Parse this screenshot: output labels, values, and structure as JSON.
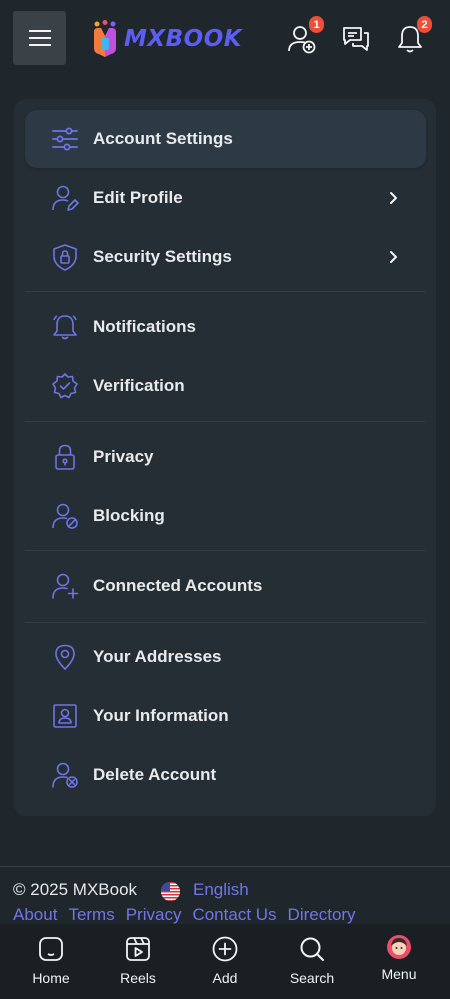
{
  "header": {
    "logo_text": "MXBOOK",
    "friend_requests_count": "1",
    "notifications_count": "2",
    "colors": {
      "brand": "#5b5ef0",
      "badge": "#ef4e3a",
      "icon": "#f2f4f6"
    }
  },
  "settings_menu": {
    "items": [
      {
        "label": "Account Settings",
        "icon": "sliders-icon",
        "active": true
      },
      {
        "label": "Edit Profile",
        "icon": "user-edit-icon",
        "has_chevron": true
      },
      {
        "label": "Security Settings",
        "icon": "shield-lock-icon",
        "has_chevron": true
      },
      {
        "label": "Notifications",
        "icon": "bell-icon"
      },
      {
        "label": "Verification",
        "icon": "verified-badge-icon"
      },
      {
        "label": "Privacy",
        "icon": "lock-icon"
      },
      {
        "label": "Blocking",
        "icon": "user-block-icon"
      },
      {
        "label": "Connected Accounts",
        "icon": "user-add-icon"
      },
      {
        "label": "Your Addresses",
        "icon": "map-pin-icon"
      },
      {
        "label": "Your Information",
        "icon": "id-card-icon"
      },
      {
        "label": "Delete Account",
        "icon": "user-delete-icon"
      }
    ],
    "colors": {
      "icon": "#6d74e6",
      "active_bg": "#2d3944"
    }
  },
  "footer": {
    "copyright": "© 2025 MXBook",
    "language": "English",
    "links": [
      "About",
      "Terms",
      "Privacy",
      "Contact Us",
      "Directory"
    ],
    "colors": {
      "link": "#6f77e8"
    }
  },
  "bottom_nav": {
    "items": [
      {
        "label": "Home",
        "icon": "home-icon"
      },
      {
        "label": "Reels",
        "icon": "reels-icon"
      },
      {
        "label": "Add",
        "icon": "plus-circle-icon"
      },
      {
        "label": "Search",
        "icon": "search-icon"
      },
      {
        "label": "Menu",
        "icon": "avatar-icon"
      }
    ]
  }
}
